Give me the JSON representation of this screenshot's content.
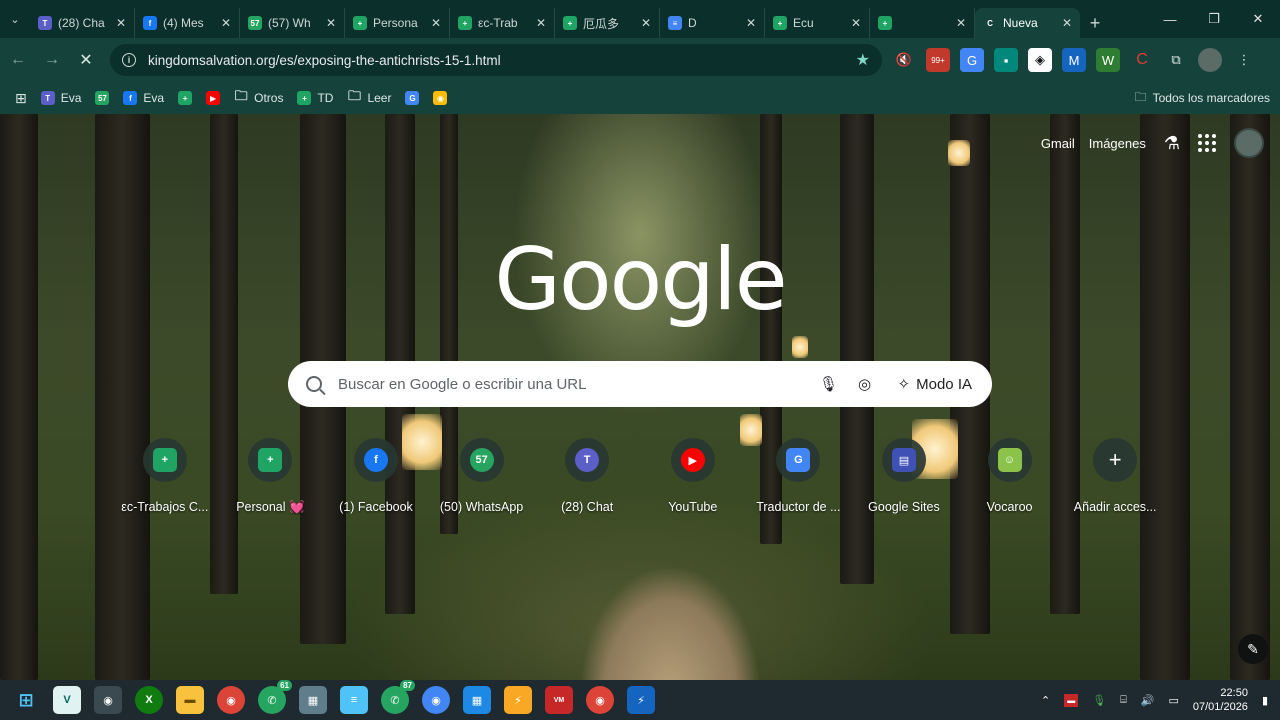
{
  "tabs": [
    {
      "title": "(28) Cha",
      "color": "#5b5fc7",
      "glyph": "T"
    },
    {
      "title": "(4) Mes",
      "color": "#1877f2",
      "glyph": "f"
    },
    {
      "title": "(57) Wh",
      "color": "#25a55f",
      "glyph": "57"
    },
    {
      "title": "Persona",
      "color": "#1fa463",
      "glyph": "+"
    },
    {
      "title": "εc-Trab",
      "color": "#1fa463",
      "glyph": "+"
    },
    {
      "title": "厄瓜多",
      "color": "#1fa463",
      "glyph": "+"
    },
    {
      "title": "D",
      "color": "#4285f4",
      "glyph": "≡"
    },
    {
      "title": "Ecu",
      "color": "#1fa463",
      "glyph": "+"
    },
    {
      "title": "",
      "color": "#1fa463",
      "glyph": "+"
    },
    {
      "title": "Nueva",
      "color": "#15433c",
      "glyph": "C"
    }
  ],
  "toolbar": {
    "url": "kingdomsalvation.org/es/exposing-the-antichrists-15-1.html",
    "ext_badge": "99+"
  },
  "bookmarks": [
    {
      "label": "Eva",
      "color": "#5b5fc7",
      "glyph": "T"
    },
    {
      "label": "",
      "color": "#25a55f",
      "glyph": "57"
    },
    {
      "label": "Eva",
      "color": "#1877f2",
      "glyph": "f"
    },
    {
      "label": "",
      "color": "#1fa463",
      "glyph": "+"
    },
    {
      "label": "",
      "color": "#ff0000",
      "glyph": "▶"
    },
    {
      "label": "Otros",
      "color": "none",
      "glyph": "folder"
    },
    {
      "label": "TD",
      "color": "#1fa463",
      "glyph": "+"
    },
    {
      "label": "Leer",
      "color": "none",
      "glyph": "folder"
    },
    {
      "label": "",
      "color": "#4285f4",
      "glyph": "G"
    },
    {
      "label": "",
      "color": "#fbbc04",
      "glyph": "◉"
    }
  ],
  "bookmarks_right": "Todos los marcadores",
  "header": {
    "gmail": "Gmail",
    "images": "Imágenes"
  },
  "logo": "Google",
  "search": {
    "placeholder": "Buscar en Google o escribir una URL",
    "ai_mode": "Modo IA"
  },
  "shortcuts": [
    {
      "label": "εc-Trabajos C...",
      "color": "#1fa463",
      "glyph": "+"
    },
    {
      "label": "Personal 💓",
      "color": "#1fa463",
      "glyph": "+"
    },
    {
      "label": "(1) Facebook",
      "color": "#1877f2",
      "glyph": "f"
    },
    {
      "label": "(50) WhatsApp",
      "color": "#25a55f",
      "glyph": "57"
    },
    {
      "label": "(28) Chat",
      "color": "#5b5fc7",
      "glyph": "T"
    },
    {
      "label": "YouTube",
      "color": "#ff0000",
      "glyph": "▶"
    },
    {
      "label": "Traductor de ...",
      "color": "#4285f4",
      "glyph": "G"
    },
    {
      "label": "Google Sites",
      "color": "#3f51b5",
      "glyph": "▤"
    },
    {
      "label": "Vocaroo",
      "color": "#8bc34a",
      "glyph": "☺"
    },
    {
      "label": "Añadir acces...",
      "color": "none",
      "glyph": "+"
    }
  ],
  "taskbar": {
    "time": "22:50",
    "date": "07/01/2026",
    "badges": {
      "whatsapp": "61",
      "whatsapp2": "87"
    }
  }
}
